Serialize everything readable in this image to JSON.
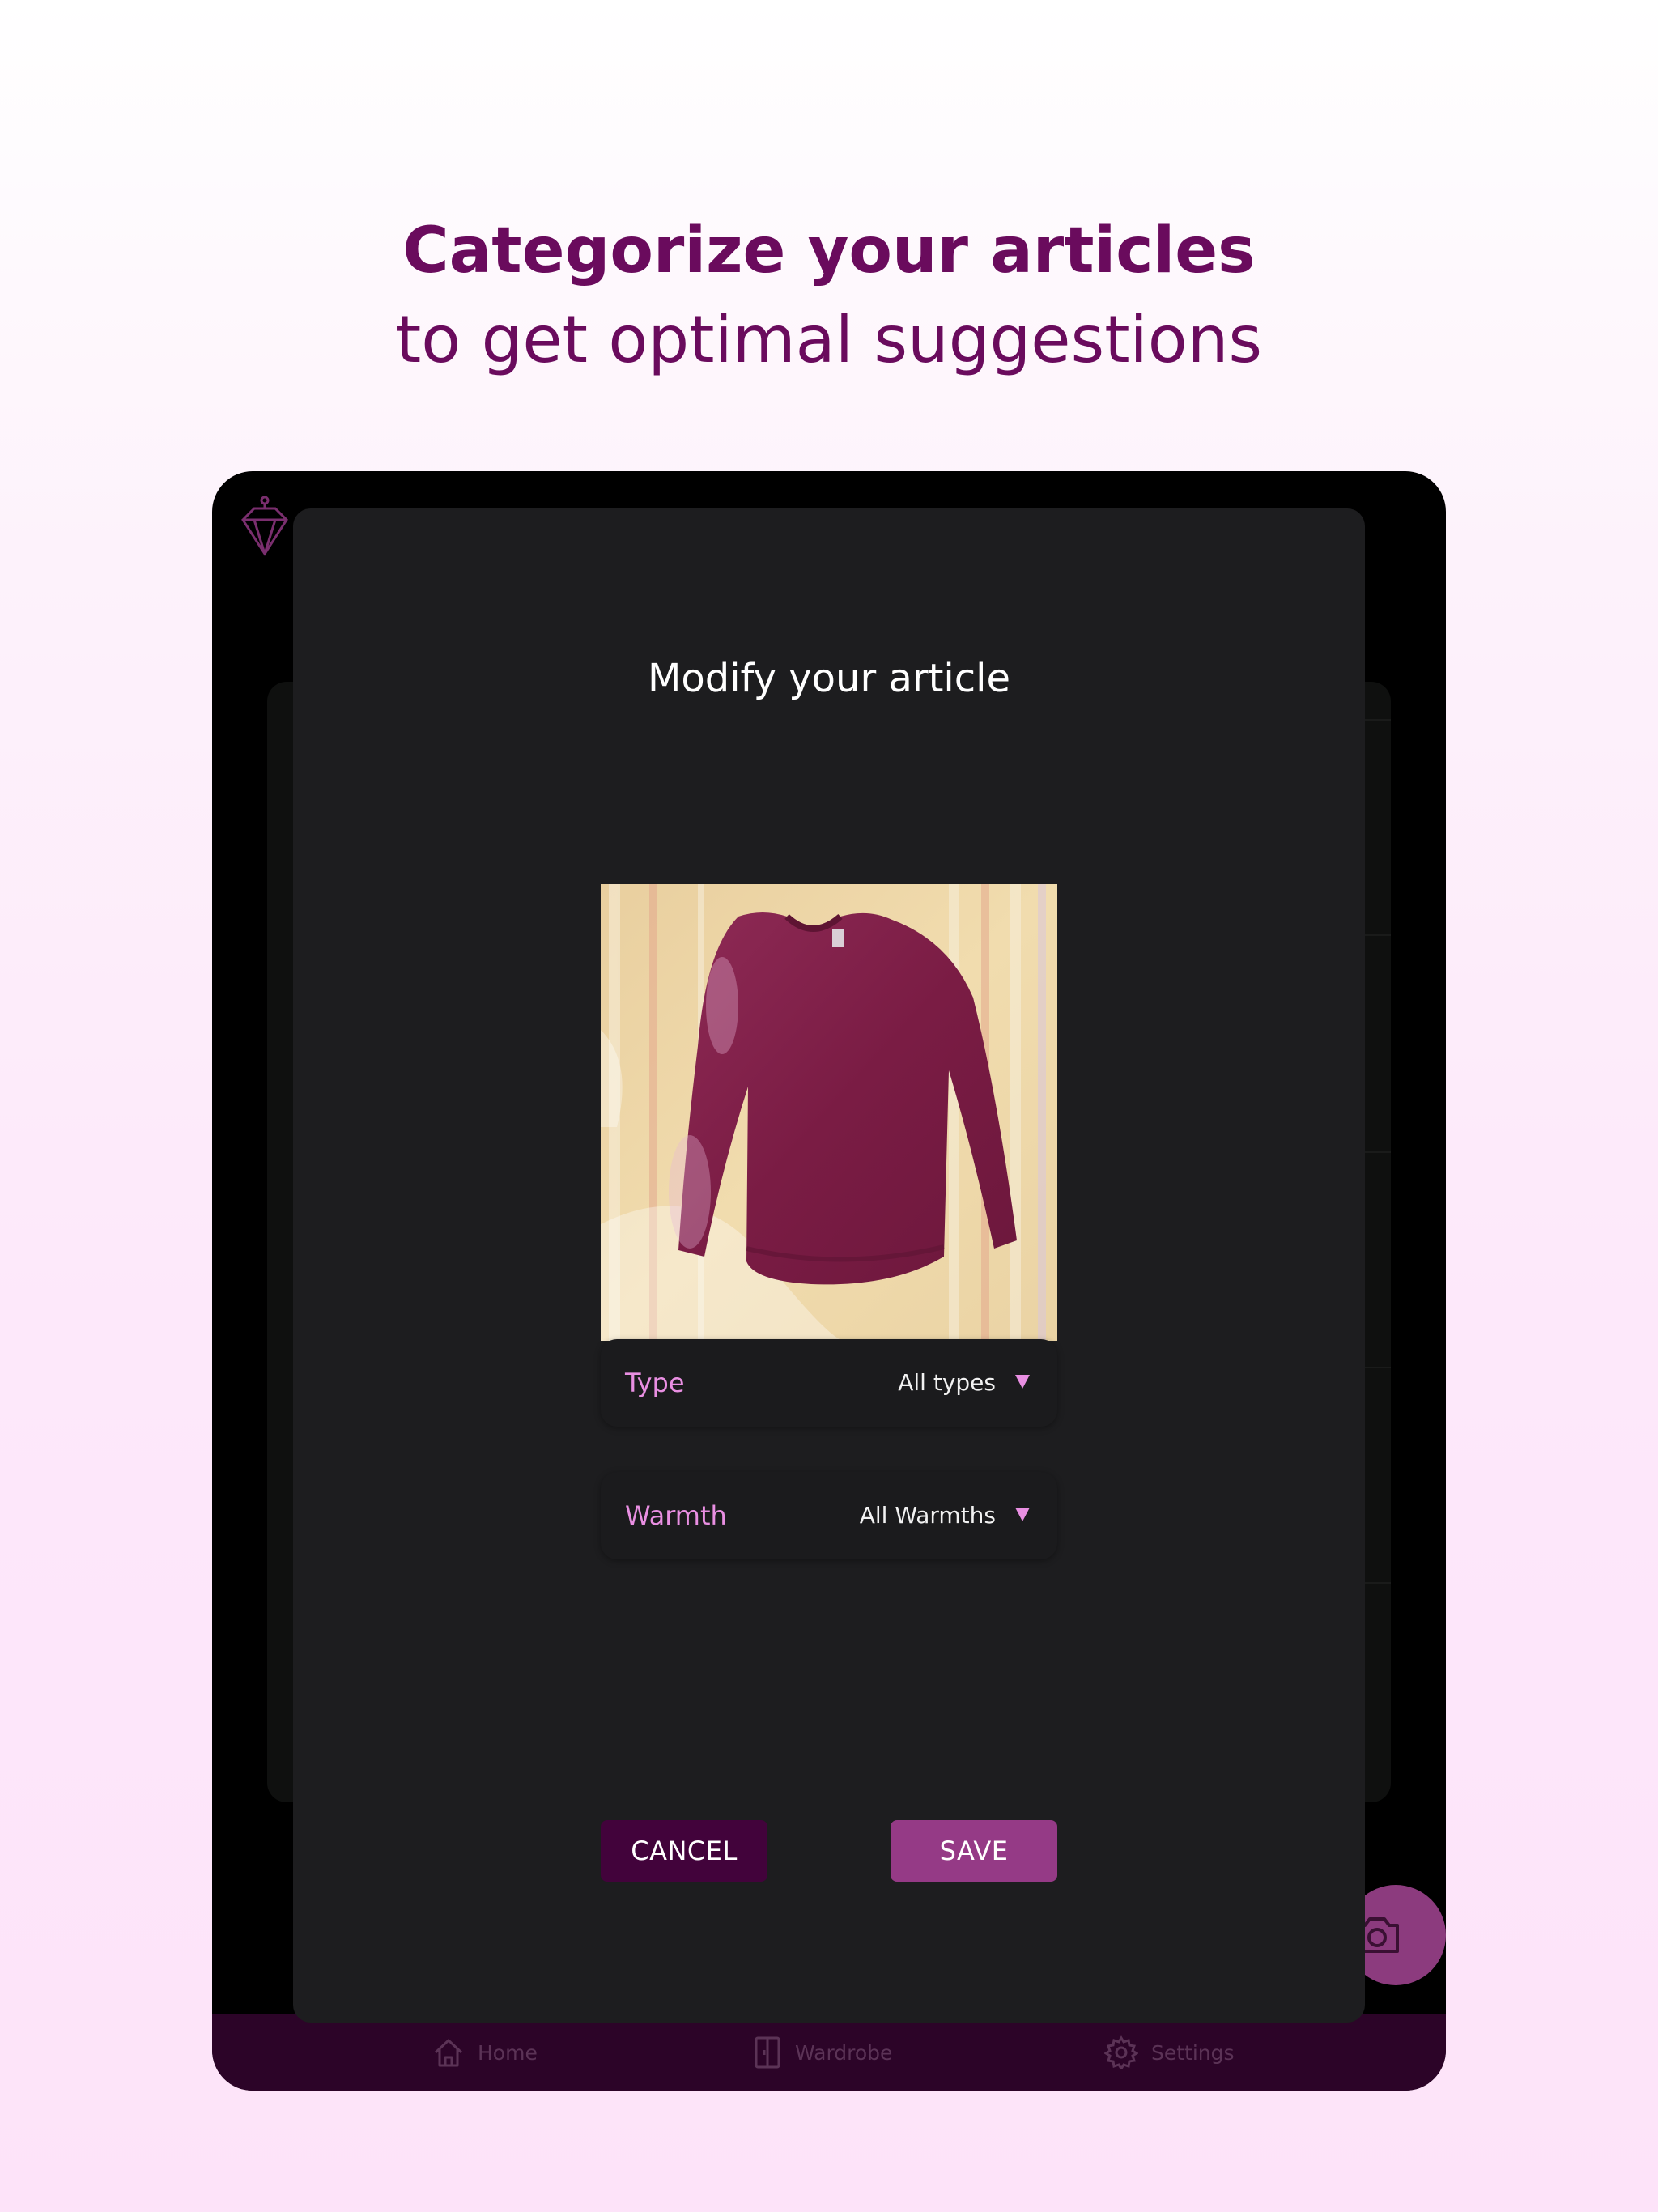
{
  "headline": {
    "title": "Categorize your articles",
    "subtitle": "to get optimal suggestions"
  },
  "background_app": {
    "tabs": [
      {
        "label": "Home",
        "icon": "home-icon"
      },
      {
        "label": "Wardrobe",
        "icon": "wardrobe-icon"
      },
      {
        "label": "Settings",
        "icon": "gear-icon"
      }
    ],
    "fab_icon": "camera-icon",
    "logo_icon": "hanger-diamond-icon"
  },
  "modal": {
    "title": "Modify your article",
    "photo_alt": "sweater-photo",
    "fields": [
      {
        "label": "Type",
        "value": "All types"
      },
      {
        "label": "Warmth",
        "value": "All Warmths"
      }
    ],
    "cancel_label": "CANCEL",
    "save_label": "SAVE"
  },
  "colors": {
    "brand_purple": "#6a0b5d",
    "accent_pink": "#e98fe2",
    "save_button": "#953a86",
    "cancel_button": "#42033b",
    "modal_bg": "#1d1d1f",
    "tabbar_bg": "#2c0428"
  }
}
